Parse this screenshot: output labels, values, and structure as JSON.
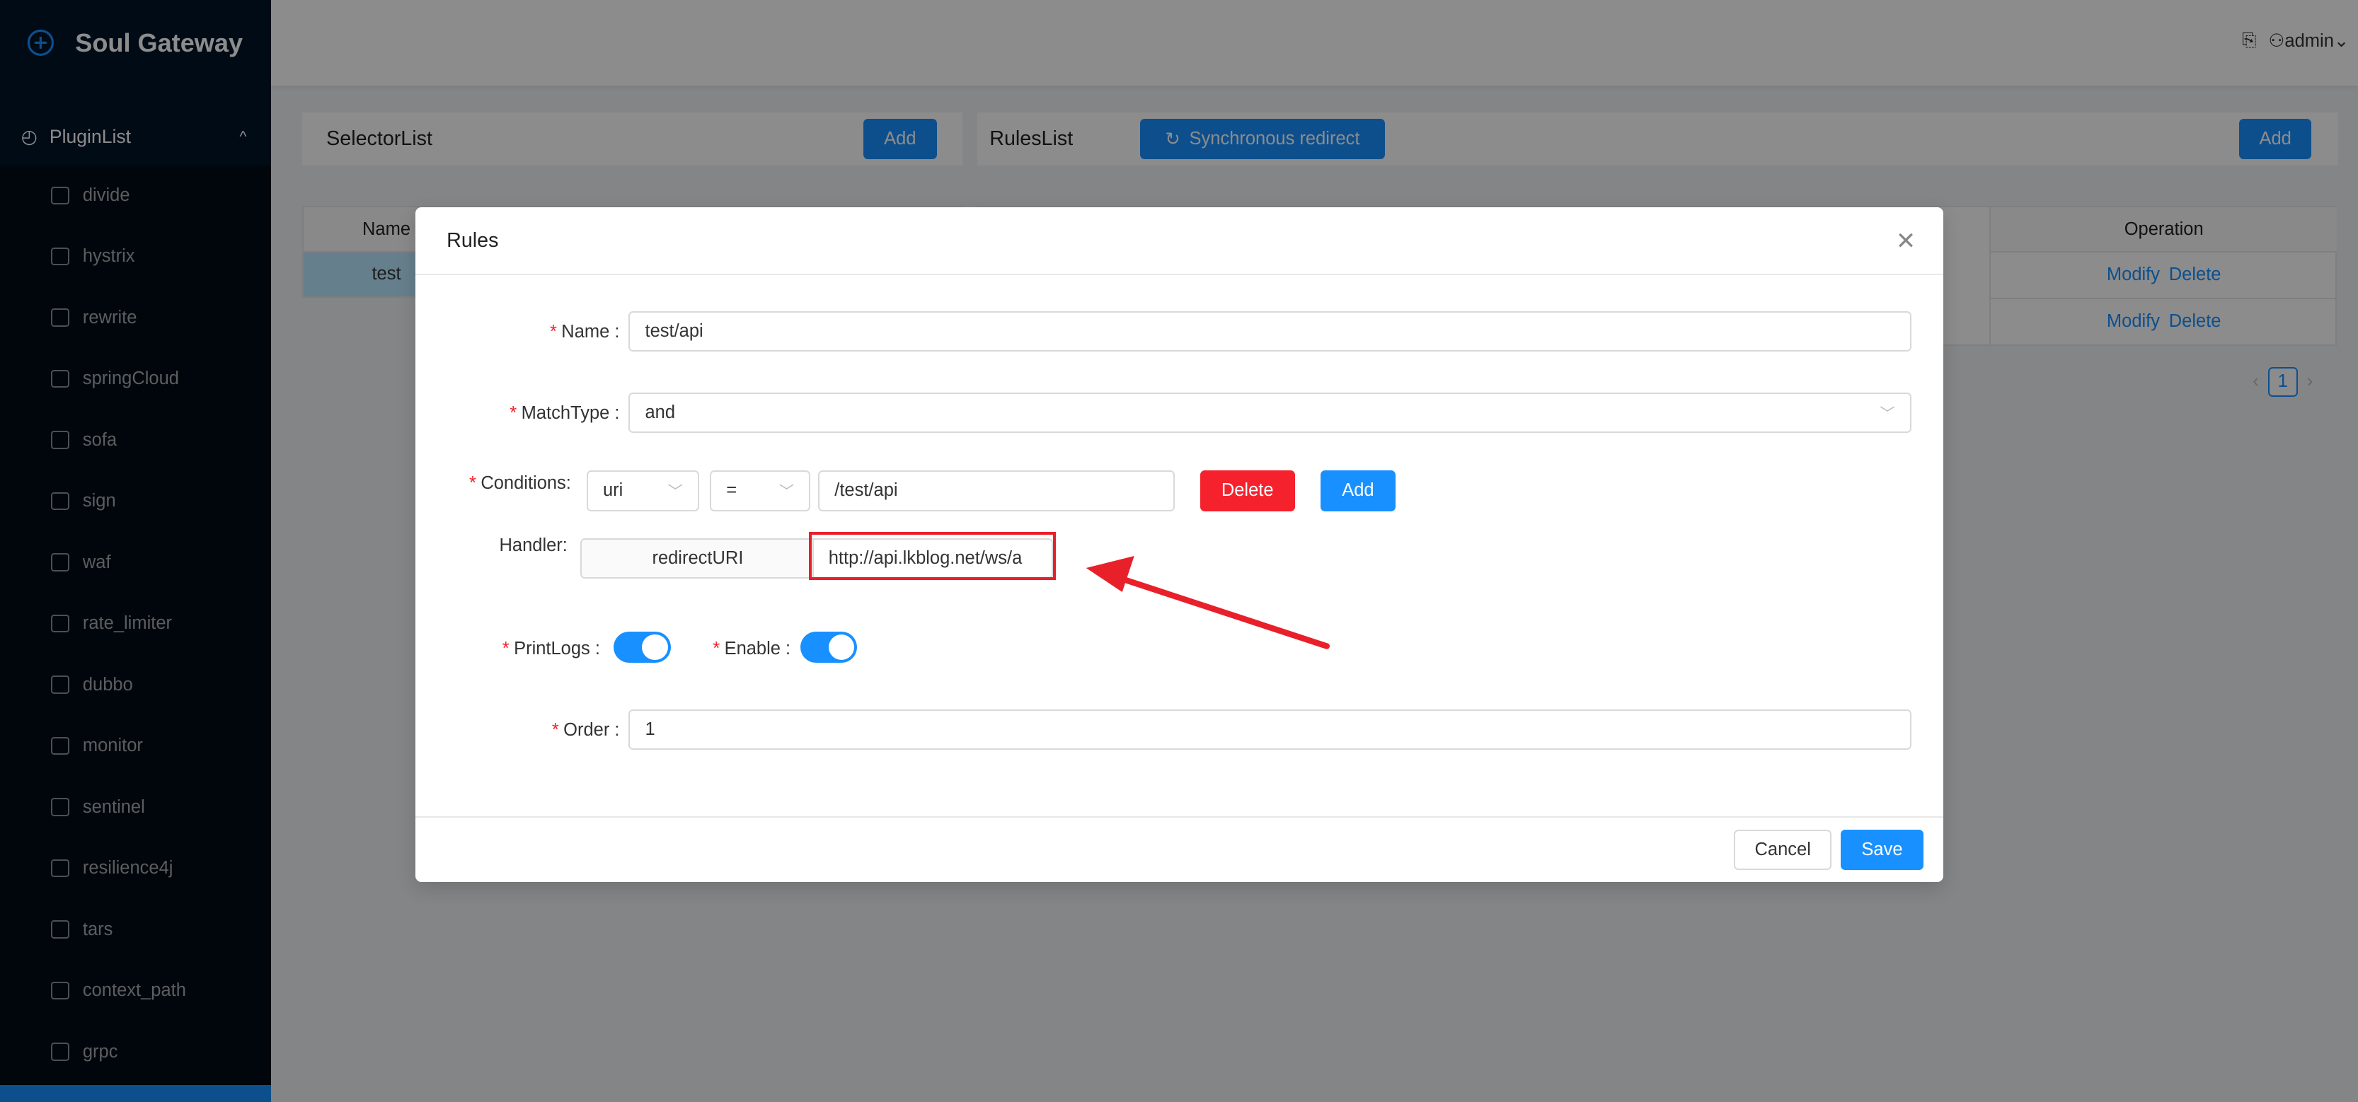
{
  "app": {
    "title": "Soul Gateway"
  },
  "sidebar": {
    "group": "PluginList",
    "items": [
      {
        "label": "divide"
      },
      {
        "label": "hystrix"
      },
      {
        "label": "rewrite"
      },
      {
        "label": "springCloud"
      },
      {
        "label": "sofa"
      },
      {
        "label": "sign"
      },
      {
        "label": "waf"
      },
      {
        "label": "rate_limiter"
      },
      {
        "label": "dubbo"
      },
      {
        "label": "monitor"
      },
      {
        "label": "sentinel"
      },
      {
        "label": "resilience4j"
      },
      {
        "label": "tars"
      },
      {
        "label": "context_path"
      },
      {
        "label": "grpc"
      }
    ]
  },
  "header": {
    "user": "admin"
  },
  "selector": {
    "title": "SelectorList",
    "add": "Add",
    "columns": [
      "Name"
    ],
    "rows": [
      {
        "name": "test"
      }
    ]
  },
  "rules": {
    "title": "RulesList",
    "sync": "Synchronous redirect",
    "add": "Add",
    "operation_header": "Operation",
    "rows": [
      {
        "modify": "Modify",
        "delete": "Delete"
      },
      {
        "modify": "Modify",
        "delete": "Delete"
      }
    ],
    "page": "1"
  },
  "modal": {
    "title": "Rules",
    "name_label": "Name",
    "name_value": "test/api",
    "matchtype_label": "MatchType",
    "matchtype_value": "and",
    "conditions_label": "Conditions:",
    "cond_param": "uri",
    "cond_op": "=",
    "cond_value": "/test/api",
    "delete": "Delete",
    "add": "Add",
    "handler_label": "Handler:",
    "handler_key": "redirectURI",
    "handler_value": "http://api.lkblog.net/ws/a",
    "printlogs_label": "PrintLogs",
    "printlogs_on": true,
    "enable_label": "Enable",
    "enable_on": true,
    "order_label": "Order",
    "order_value": "1",
    "cancel": "Cancel",
    "save": "Save"
  },
  "colors": {
    "primary": "#1890ff",
    "danger": "#f5222d",
    "sidebar": "#001529",
    "annotation": "#e8202a"
  }
}
